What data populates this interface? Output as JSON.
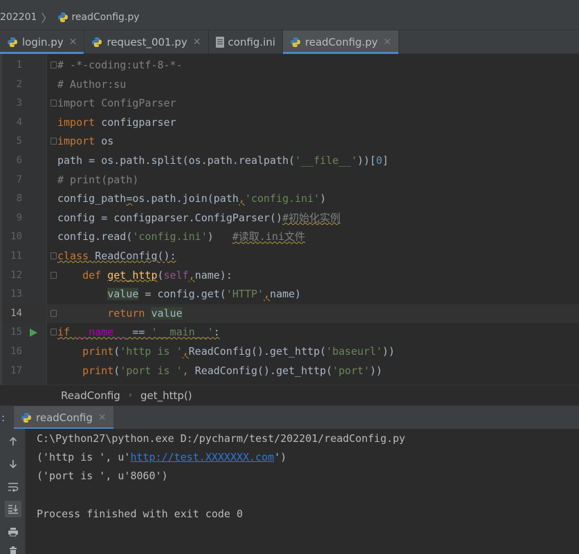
{
  "breadcrumb": {
    "folder": "202201",
    "file": "readConfig.py"
  },
  "tabs": [
    {
      "label": "login.py",
      "icon": "python-file-icon"
    },
    {
      "label": "request_001.py",
      "icon": "python-file-icon"
    },
    {
      "label": "config.ini",
      "icon": "ini-file-icon"
    },
    {
      "label": "readConfig.py",
      "icon": "python-file-icon",
      "active": true
    }
  ],
  "editor": {
    "current_line": 14,
    "line_numbers": [
      "1",
      "2",
      "3",
      "4",
      "5",
      "6",
      "7",
      "8",
      "9",
      "10",
      "11",
      "12",
      "13",
      "14",
      "15",
      "16",
      "17"
    ],
    "lines": [
      [
        {
          "t": "# -*-coding:utf-8-*-",
          "c": "cm"
        }
      ],
      [
        {
          "t": "# Author:su",
          "c": "cm"
        }
      ],
      [
        {
          "t": "import ",
          "c": "unused"
        },
        {
          "t": "ConfigParser",
          "c": "unused"
        }
      ],
      [
        {
          "t": "import ",
          "c": "kw"
        },
        {
          "t": "configparser",
          "c": "tx"
        }
      ],
      [
        {
          "t": "import ",
          "c": "kw"
        },
        {
          "t": "os",
          "c": "tx"
        }
      ],
      [
        {
          "t": "path = os.path.split(os.path.realpath(",
          "c": "tx"
        },
        {
          "t": "'__file__'",
          "c": "st"
        },
        {
          "t": "))[",
          "c": "tx"
        },
        {
          "t": "0",
          "c": "nm"
        },
        {
          "t": "]",
          "c": "tx"
        }
      ],
      [
        {
          "t": "# print(path)",
          "c": "cm"
        }
      ],
      [
        {
          "t": "config_path",
          "c": "tx"
        },
        {
          "t": "=",
          "c": "tx wavy"
        },
        {
          "t": "os.path.join(path",
          "c": "tx"
        },
        {
          "t": ",",
          "c": "kw wavy"
        },
        {
          "t": "'config.ini'",
          "c": "st"
        },
        {
          "t": ")",
          "c": "tx"
        }
      ],
      [
        {
          "t": "config = configparser.ConfigParser()",
          "c": "tx"
        },
        {
          "t": "#初始化实例",
          "c": "cm wavy"
        }
      ],
      [
        {
          "t": "config.read(",
          "c": "tx"
        },
        {
          "t": "'config.ini'",
          "c": "st"
        },
        {
          "t": ")   ",
          "c": "tx"
        },
        {
          "t": "#读取.ini文件",
          "c": "cm wavy"
        }
      ],
      [
        {
          "t": "class ",
          "c": "kw wavy"
        },
        {
          "t": "ReadConfig():",
          "c": "tx wavy"
        }
      ],
      [
        {
          "t": "    "
        },
        {
          "t": "def ",
          "c": "kw"
        },
        {
          "t": "get_http",
          "c": "fn wavy"
        },
        {
          "t": "(",
          "c": "tx"
        },
        {
          "t": "self",
          "c": "sf"
        },
        {
          "t": ",",
          "c": "kw wavy"
        },
        {
          "t": "name):",
          "c": "tx"
        }
      ],
      [
        {
          "t": "        "
        },
        {
          "t": "value",
          "c": "tx hl"
        },
        {
          "t": " = config.get(",
          "c": "tx"
        },
        {
          "t": "'HTTP'",
          "c": "st"
        },
        {
          "t": ",",
          "c": "kw wavy"
        },
        {
          "t": "name)",
          "c": "tx"
        }
      ],
      [
        {
          "t": "        "
        },
        {
          "t": "return ",
          "c": "kw"
        },
        {
          "t": "value",
          "c": "tx hl"
        }
      ],
      [
        {
          "t": "if ",
          "c": "kw wavy"
        },
        {
          "t": "__name__",
          "c": "mg wavy"
        },
        {
          "t": " == ",
          "c": "tx wavy"
        },
        {
          "t": "'__main__'",
          "c": "st wavy"
        },
        {
          "t": ":",
          "c": "tx wavy"
        }
      ],
      [
        {
          "t": "    "
        },
        {
          "t": "print",
          "c": "kw"
        },
        {
          "t": "(",
          "c": "tx"
        },
        {
          "t": "'http is '",
          "c": "st"
        },
        {
          "t": ",",
          "c": "kw wavy"
        },
        {
          "t": "ReadConfig().get_http(",
          "c": "tx"
        },
        {
          "t": "'baseurl'",
          "c": "st"
        },
        {
          "t": "))",
          "c": "tx"
        }
      ],
      [
        {
          "t": "    "
        },
        {
          "t": "print",
          "c": "kw"
        },
        {
          "t": "(",
          "c": "tx"
        },
        {
          "t": "'port is '",
          "c": "st"
        },
        {
          "t": ", ",
          "c": "kw"
        },
        {
          "t": "ReadConfig().get_http(",
          "c": "tx"
        },
        {
          "t": "'port'",
          "c": "st"
        },
        {
          "t": "))",
          "c": "tx"
        }
      ]
    ]
  },
  "structure_crumbs": [
    "ReadConfig",
    "get_http()"
  ],
  "run_panel": {
    "label": ":",
    "tab": "readConfig",
    "output": [
      [
        {
          "t": "C:\\Python27\\python.exe D:/pycharm/test/202201/readConfig.py"
        }
      ],
      [
        {
          "t": "('http is ', u'"
        },
        {
          "t": "http://test.XXXXXXX.com",
          "link": true
        },
        {
          "t": "')"
        }
      ],
      [
        {
          "t": "('port is ', u'8060')"
        }
      ],
      [
        {
          "t": ""
        }
      ],
      [
        {
          "t": "Process finished with exit code 0"
        }
      ]
    ]
  },
  "colors": {
    "accent": "#4a88c7",
    "run_arrow": "#499c54",
    "keyword": "#cc7832",
    "string": "#6a8759",
    "comment": "#808080",
    "link": "#287bde"
  }
}
